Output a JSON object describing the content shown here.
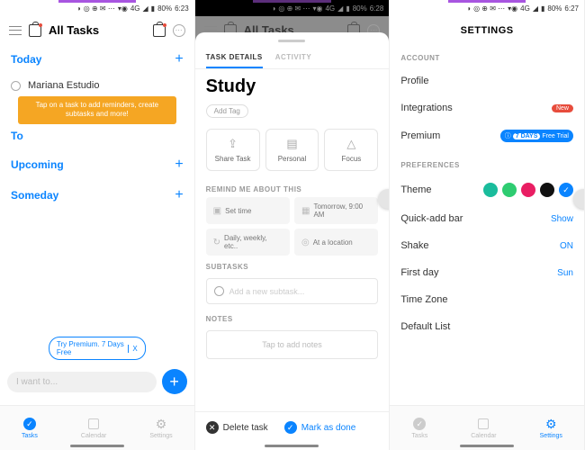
{
  "status": {
    "battery_pct": "80%",
    "signal_label": "4G",
    "time_s1": "6:23",
    "time_s2": "6:28",
    "time_s3": "6:27"
  },
  "screen1": {
    "title": "All Tasks",
    "sections": {
      "today": "Today",
      "tomorrow_short": "To",
      "upcoming": "Upcoming",
      "someday": "Someday"
    },
    "task1": "Mariana Estudio",
    "tooltip": "Tap on a task to add reminders, create subtasks and more!",
    "premium_pill": "Try Premium. 7 Days Free",
    "premium_close": "X",
    "input_placeholder": "I want to...",
    "nav": {
      "tasks": "Tasks",
      "calendar": "Calendar",
      "settings": "Settings"
    }
  },
  "screen2": {
    "header_title": "All Tasks",
    "tabs": {
      "details": "TASK DETAILS",
      "activity": "ACTIVITY"
    },
    "title": "Study",
    "add_tag": "Add Tag",
    "actions": {
      "share": "Share Task",
      "personal": "Personal",
      "focus": "Focus"
    },
    "remind_header": "REMIND ME ABOUT THIS",
    "reminders": {
      "set_time": "Set time",
      "tomorrow": "Tomorrow, 9:00 AM",
      "repeat": "Daily, weekly, etc..",
      "location": "At a location"
    },
    "subtasks_header": "SUBTASKS",
    "subtask_placeholder": "Add a new subtask...",
    "notes_header": "NOTES",
    "notes_placeholder": "Tap to add notes",
    "delete": "Delete task",
    "done": "Mark as done"
  },
  "screen3": {
    "title": "SETTINGS",
    "account_header": "ACCOUNT",
    "rows": {
      "profile": "Profile",
      "integrations": "Integrations",
      "premium": "Premium",
      "theme": "Theme",
      "quickadd": "Quick-add bar",
      "shake": "Shake",
      "firstday": "First day",
      "timezone": "Time Zone",
      "defaultlist": "Default List"
    },
    "badges": {
      "new": "New",
      "premium_days": "7 DAYS",
      "premium_trial": "Free Trial"
    },
    "prefs_header": "PREFERENCES",
    "values": {
      "quickadd": "Show",
      "shake": "ON",
      "firstday": "Sun"
    },
    "theme_colors": [
      "#1abc9c",
      "#2ecc71",
      "#e91e63",
      "#111111",
      "#0a84ff"
    ],
    "nav": {
      "tasks": "Tasks",
      "calendar": "Calendar",
      "settings": "Settings"
    }
  }
}
